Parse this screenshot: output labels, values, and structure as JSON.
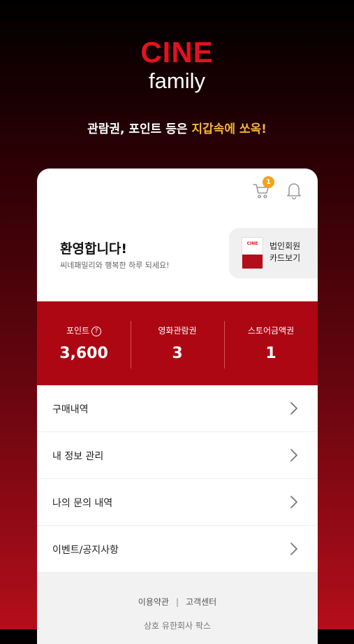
{
  "brand": {
    "logo_main": "CINE",
    "logo_sub": "family"
  },
  "tagline": {
    "prefix": "관람권, 포인트 등은 ",
    "highlight": "지갑속에 쏘옥!"
  },
  "header": {
    "cart_badge": "1",
    "icons": [
      "cart-icon",
      "bell-icon"
    ]
  },
  "welcome": {
    "title": "환영합니다!",
    "subtitle": "씨네패밀리와 행복한 하루 되세요!"
  },
  "corporate_card": {
    "thumb_text": "CINE",
    "line1": "법인회원",
    "line2": "카드보기"
  },
  "stats": [
    {
      "label": "포인트",
      "value": "3,600",
      "help_icon": "?"
    },
    {
      "label": "영화관람권",
      "value": "3"
    },
    {
      "label": "스토어금액권",
      "value": "1"
    }
  ],
  "menu": [
    {
      "label": "구매내역"
    },
    {
      "label": "내 정보 관리"
    },
    {
      "label": "나의 문의 내역"
    },
    {
      "label": "이벤트/공지사항"
    }
  ],
  "footer": {
    "link1": "이용약관",
    "separator": "|",
    "link2": "고객센터",
    "company": "상호  유한회사 팍스"
  },
  "colors": {
    "accent_red": "#ad0713",
    "logo_red": "#e3121f",
    "highlight_yellow": "#f5b43a",
    "badge_orange": "#f3a21b"
  }
}
